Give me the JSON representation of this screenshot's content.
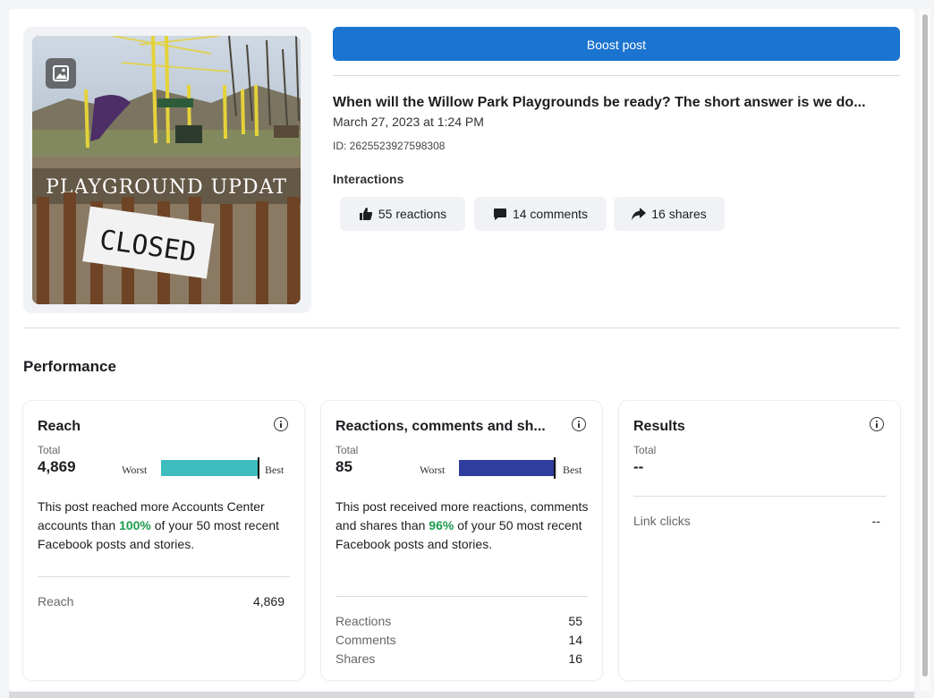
{
  "boost_button": "Boost post",
  "post": {
    "title": "When will the Willow Park Playgrounds be ready? The short answer is we do...",
    "date": "March 27, 2023 at 1:24 PM",
    "id": "ID: 2625523927598308",
    "image_text": {
      "banner": "PLAYGROUND UPDAT",
      "sign": "CLOSED"
    }
  },
  "interactions": {
    "label": "Interactions",
    "reactions": "55 reactions",
    "comments": "14 comments",
    "shares": "16 shares"
  },
  "performance": {
    "title": "Performance",
    "reach": {
      "title": "Reach",
      "total_label": "Total",
      "total": "4,869",
      "worst": "Worst",
      "best": "Best",
      "bar_color": "#3dbdbd",
      "bar_level": 1.0,
      "desc_before": "This post reached more Accounts Center accounts than ",
      "desc_pct": "100%",
      "desc_after": " of your 50 most recent Facebook posts and stories.",
      "row_label": "Reach",
      "row_value": "4,869"
    },
    "engagement": {
      "title": "Reactions, comments and sh...",
      "total_label": "Total",
      "total": "85",
      "worst": "Worst",
      "best": "Best",
      "bar_color": "#2f3d9e",
      "bar_level": 0.96,
      "desc_before": "This post received more reactions, comments and shares than ",
      "desc_pct": "96%",
      "desc_after": " of your 50 most recent Facebook posts and stories.",
      "rows": [
        {
          "label": "Reactions",
          "value": "55"
        },
        {
          "label": "Comments",
          "value": "14"
        },
        {
          "label": "Shares",
          "value": "16"
        }
      ]
    },
    "results": {
      "title": "Results",
      "total_label": "Total",
      "total": "--",
      "row_label": "Link clicks",
      "row_value": "--"
    }
  },
  "icons": [
    "image-icon",
    "thumbs-up-icon",
    "comment-icon",
    "share-icon",
    "info-icon"
  ]
}
